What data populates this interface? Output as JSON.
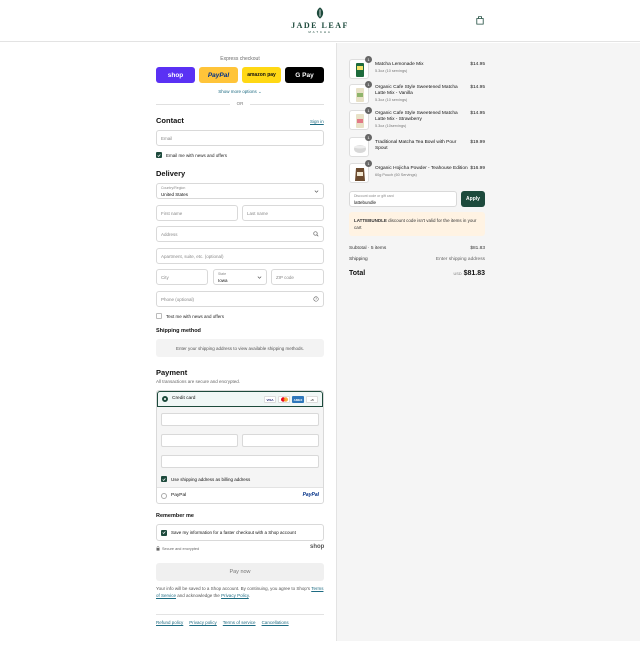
{
  "header": {
    "brand": "JADE LEAF",
    "brand_sub": "MATCHA",
    "cart_icon": "shopping-bag-icon"
  },
  "express": {
    "title": "Express checkout",
    "buttons": {
      "shop": "shop",
      "paypal": "PayPal",
      "amazon": "amazon pay",
      "gpay": "G Pay"
    },
    "more_options": "Show more options",
    "or": "OR"
  },
  "contact": {
    "title": "Contact",
    "sign_in": "Sign in",
    "email_placeholder": "Email",
    "email_opt_in": "Email me with news and offers",
    "email_opt_in_checked": true
  },
  "delivery": {
    "title": "Delivery",
    "country_label": "Country/Region",
    "country_value": "United States",
    "first_name": "First name",
    "last_name": "Last name",
    "address": "Address",
    "apartment": "Apartment, suite, etc. (optional)",
    "city": "City",
    "state_label": "State",
    "state_value": "Iowa",
    "zip": "ZIP code",
    "phone": "Phone (optional)",
    "text_opt_in": "Text me with news and offers",
    "text_opt_in_checked": false
  },
  "shipping": {
    "title": "Shipping method",
    "info": "Enter your shipping address to view available shipping methods."
  },
  "payment": {
    "title": "Payment",
    "subtitle": "All transactions are secure and encrypted.",
    "credit_card": "Credit card",
    "card_logos": [
      "VISA",
      "MC",
      "AMEX",
      "+5"
    ],
    "billing_same": "Use shipping address as billing address",
    "billing_same_checked": true,
    "paypal": "PayPal",
    "paypal_logo": "PayPal"
  },
  "remember": {
    "title": "Remember me",
    "save_info": "Save my information for a faster checkout with a Shop account",
    "save_info_checked": true,
    "secure_note": "Secure and encrypted",
    "shop_logo": "shop"
  },
  "pay_now": "Pay now",
  "legal": {
    "text1": "Your info will be saved to a Shop account. By continuing, you agree to Shop's",
    "terms": "Terms of Service",
    "text2": " and acknowledge the ",
    "privacy": "Privacy Policy",
    "text3": "."
  },
  "footer_links": [
    "Refund policy",
    "Privacy policy",
    "Terms of service",
    "Cancellations"
  ],
  "cart": {
    "items": [
      {
        "name": "Matcha Lemonade Mix",
        "variant": "5.3oz (10 servings)",
        "price": "$14.95",
        "qty": "1"
      },
      {
        "name": "Organic Cafe Style Sweetened Matcha Latte Mix - Vanilla",
        "variant": "5.3oz (10 servings)",
        "price": "$14.95",
        "qty": "1"
      },
      {
        "name": "Organic Cafe Style Sweetened Matcha Latte Mix - Strawberry",
        "variant": "5.3oz (10servings)",
        "price": "$14.95",
        "qty": "1"
      },
      {
        "name": "Traditional Matcha Tea Bowl with Pour Spout",
        "variant": "",
        "price": "$19.99",
        "qty": "1"
      },
      {
        "name": "Organic Hojicha Powder - Teahouse Edition",
        "variant": "60g Pouch (60 Servings)",
        "price": "$16.99",
        "qty": "1"
      }
    ],
    "discount_label": "Discount code or gift card",
    "discount_value": "lattebundle",
    "apply": "Apply",
    "warning_code": "LATTEBUNDLE",
    "warning_text": " discount code isn't valid for the items in your cart",
    "subtotal_label": "Subtotal · 5 items",
    "subtotal_value": "$81.83",
    "shipping_label": "Shipping",
    "shipping_value": "Enter shipping address",
    "total_label": "Total",
    "total_currency": "USD",
    "total_value": "$81.83"
  },
  "colors": {
    "brand": "#1d4a3c",
    "link": "#1d6b82",
    "shop": "#5a31f4",
    "paypal": "#ffc439"
  }
}
